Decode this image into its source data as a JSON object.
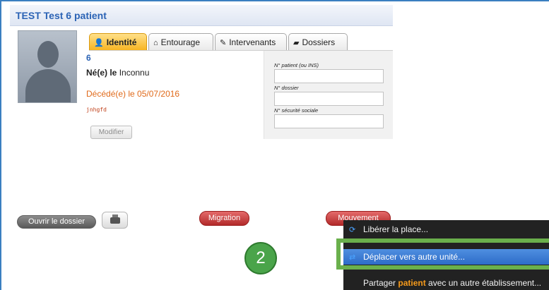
{
  "patient": {
    "title": "TEST Test 6 patient",
    "number": "6",
    "born_label": "Né(e) le",
    "born_value": "Inconnu",
    "deceased": "Décédé(e) le 05/07/2016",
    "code": "jnhgfd",
    "modify_label": "Modifier"
  },
  "tabs": [
    {
      "label": "Identité",
      "icon": "person-icon",
      "active": true
    },
    {
      "label": "Entourage",
      "icon": "house-icon",
      "active": false
    },
    {
      "label": "Intervenants",
      "icon": "tools-icon",
      "active": false
    },
    {
      "label": "Dossiers",
      "icon": "folder-icon",
      "active": false
    }
  ],
  "id_panel": {
    "patient_no_label": "N° patient (ou INS)",
    "patient_no_value": "",
    "dossier_label": "N° dossier",
    "dossier_value": "",
    "secu_label": "N° sécurité sociale",
    "secu_value": ""
  },
  "actions": {
    "open_folder": "Ouvrir le dossier",
    "migration": "Migration",
    "movement": "Mouvement"
  },
  "menu": {
    "items": [
      {
        "label": "Libérer la place...",
        "icon": "refresh-icon"
      },
      {
        "label": "Déplacer vers autre unité...",
        "icon": "shuffle-icon"
      },
      {
        "label_pre": "Partager ",
        "label_highlight": "patient",
        "label_post": " avec un autre établissement..."
      }
    ]
  },
  "badge": "2",
  "colors": {
    "title_blue": "#2b63b5",
    "tab_active": "#f7b31e",
    "deceased_orange": "#e06a1a",
    "action_red": "#b22a2a",
    "menu_highlight": "#2d6cc8",
    "green_highlight": "#6ab04c"
  }
}
